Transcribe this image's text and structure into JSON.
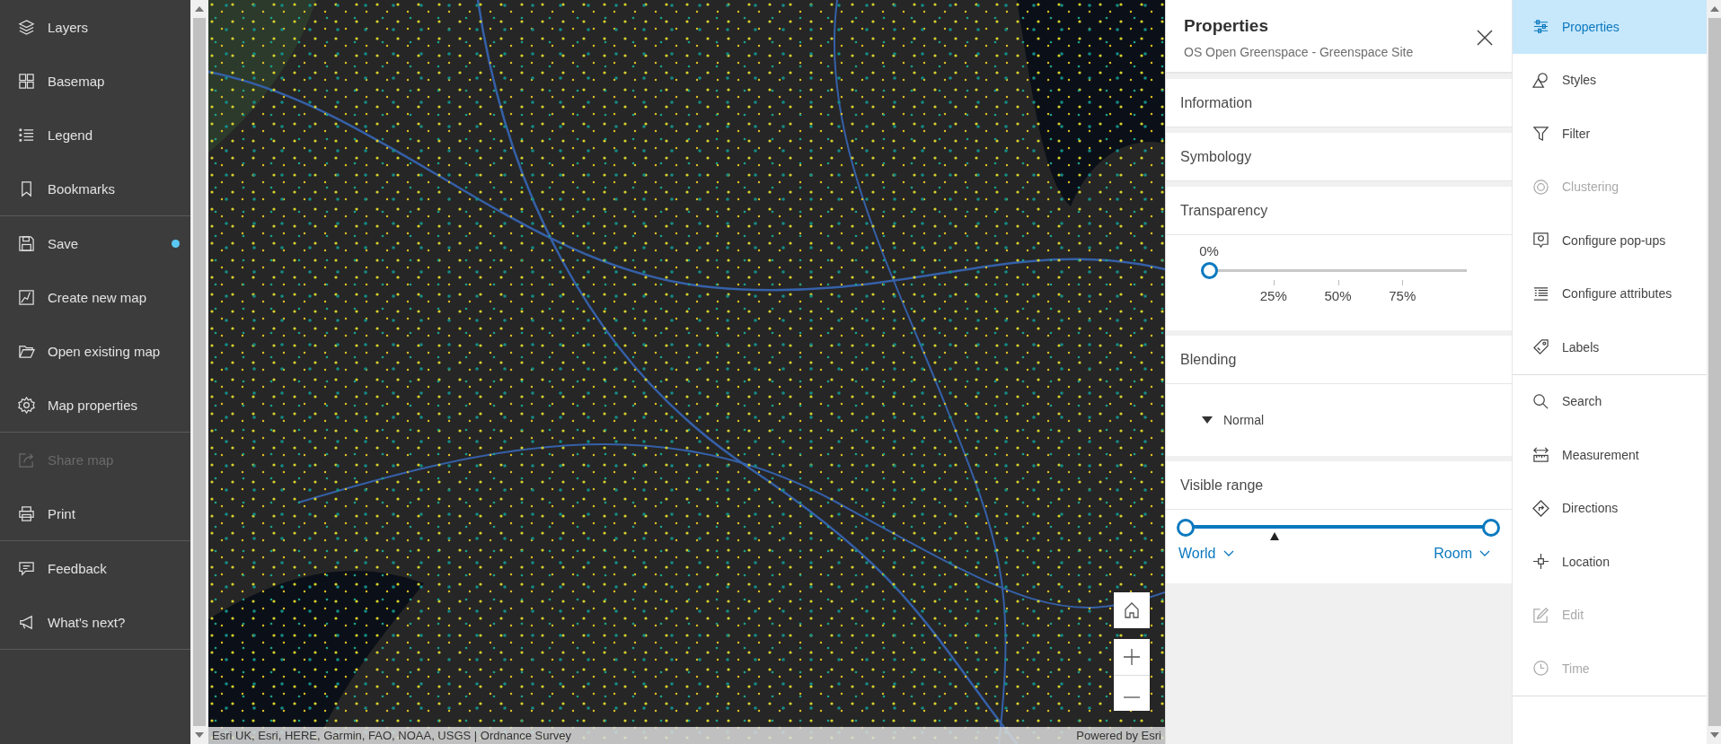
{
  "left_nav": {
    "groups": [
      {
        "items": [
          {
            "label": "Layers",
            "disabled": false,
            "notification": false
          },
          {
            "label": "Basemap",
            "disabled": false,
            "notification": false
          },
          {
            "label": "Legend",
            "disabled": false,
            "notification": false
          },
          {
            "label": "Bookmarks",
            "disabled": false,
            "notification": false
          }
        ]
      },
      {
        "items": [
          {
            "label": "Save",
            "disabled": false,
            "notification": true
          },
          {
            "label": "Create new map",
            "disabled": false,
            "notification": false
          },
          {
            "label": "Open existing map",
            "disabled": false,
            "notification": false
          },
          {
            "label": "Map properties",
            "disabled": false,
            "notification": false
          }
        ]
      },
      {
        "items": [
          {
            "label": "Share map",
            "disabled": true,
            "notification": false
          },
          {
            "label": "Print",
            "disabled": false,
            "notification": false
          }
        ]
      },
      {
        "items": [
          {
            "label": "Feedback",
            "disabled": false,
            "notification": false
          },
          {
            "label": "What's next?",
            "disabled": false,
            "notification": false
          }
        ]
      }
    ]
  },
  "map": {
    "attribution": "Esri UK, Esri, HERE, Garmin, FAO, NOAA, USGS | Ordnance Survey",
    "powered_by": "Powered by Esri"
  },
  "properties_panel": {
    "title": "Properties",
    "subtitle": "OS Open Greenspace - Greenspace Site",
    "sections": [
      {
        "kind": "header",
        "label": "Information"
      },
      {
        "kind": "header",
        "label": "Symbology"
      },
      {
        "kind": "transparency",
        "label": "Transparency",
        "reading": "0%",
        "level": 0,
        "ticks": [
          "25%",
          "50%",
          "75%"
        ]
      },
      {
        "kind": "blending",
        "label": "Blending",
        "value": "Normal"
      },
      {
        "kind": "visible_range",
        "label": "Visible range",
        "current_scale": {
          "level": 0.29
        },
        "min": "World",
        "max": "Room"
      }
    ]
  },
  "tools": {
    "groups": [
      {
        "items": [
          {
            "label": "Properties",
            "selected": true,
            "disabled": false
          },
          {
            "label": "Styles",
            "selected": false,
            "disabled": false
          },
          {
            "label": "Filter",
            "selected": false,
            "disabled": false
          },
          {
            "label": "Clustering",
            "selected": false,
            "disabled": true
          },
          {
            "label": "Configure pop-ups",
            "selected": false,
            "disabled": false
          },
          {
            "label": "Configure attributes",
            "selected": false,
            "disabled": false
          },
          {
            "label": "Labels",
            "selected": false,
            "disabled": false
          }
        ]
      },
      {
        "items": [
          {
            "label": "Search",
            "selected": false,
            "disabled": false
          },
          {
            "label": "Measurement",
            "selected": false,
            "disabled": false
          },
          {
            "label": "Directions",
            "selected": false,
            "disabled": false
          },
          {
            "label": "Location",
            "selected": false,
            "disabled": false
          },
          {
            "label": "Edit",
            "selected": false,
            "disabled": true
          },
          {
            "label": "Time",
            "selected": false,
            "disabled": true
          }
        ]
      }
    ]
  }
}
